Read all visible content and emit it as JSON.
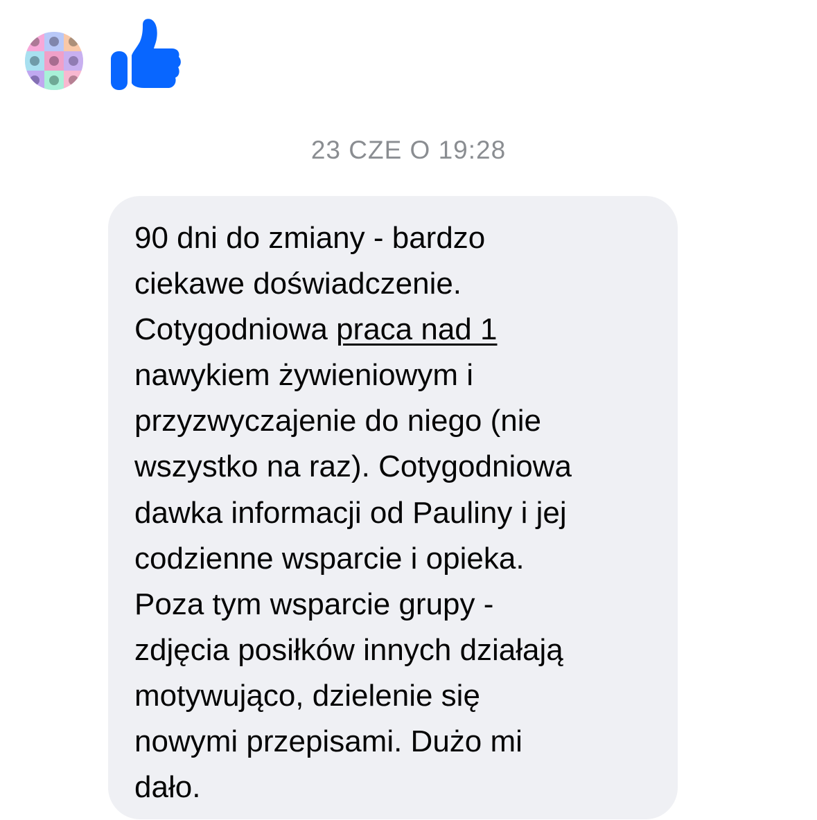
{
  "sender": {
    "avatar_icon": "profile-avatar-icon"
  },
  "reaction": {
    "icon": "thumbs-up-icon",
    "color": "#0866ff"
  },
  "timestamp": "23 CZE O 19:28",
  "message": {
    "bubble_color": "#eff0f4",
    "lines": [
      "90 dni do zmiany - bardzo",
      "ciekawe doświadczenie.",
      "Cotygodniowa ",
      "nawykiem żywieniowym i",
      "przyzwyczajenie do niego (nie",
      "wszystko na raz). Cotygodniowa",
      "dawka informacji od Pauliny i jej",
      "codzienne wsparcie i opieka.",
      "Poza tym wsparcie grupy -",
      "zdjęcia posiłków innych działają",
      "motywująco, dzielenie się",
      "nowymi przepisami. Dużo mi",
      "dało."
    ],
    "link_text": "praca nad 1"
  }
}
